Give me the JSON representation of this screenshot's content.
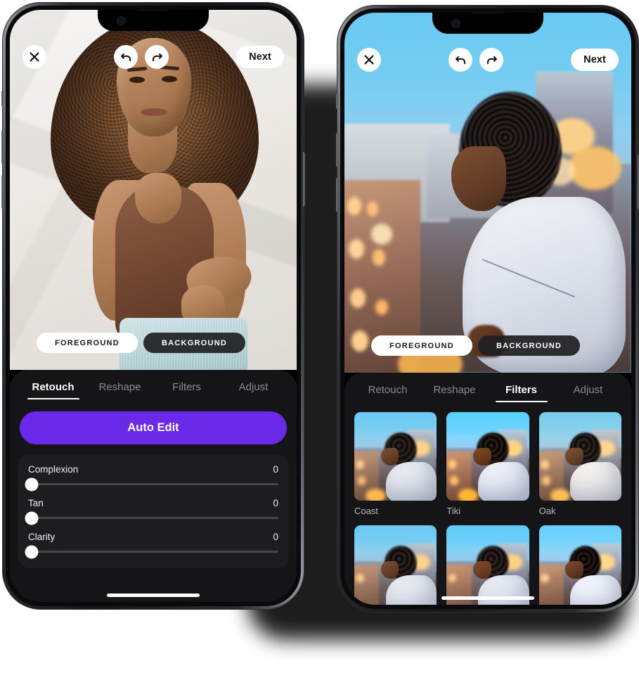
{
  "app": {
    "name": "Photo Editor",
    "accent_purple": "#6A29E9",
    "sheet_background": "#151517",
    "card_background": "#1d1d1f"
  },
  "phones": [
    {
      "id": "left-phone",
      "photo": "studio-portrait-curly-hair-brown-top",
      "toolbar": {
        "close_label": "×",
        "close_icon": "close-icon",
        "undo_icon": "undo-arrow-icon",
        "redo_icon": "redo-arrow-icon",
        "next_label": "Next"
      },
      "segment": {
        "foreground_label": "FOREGROUND",
        "background_label": "BACKGROUND",
        "selected": "FOREGROUND"
      },
      "tabs": [
        {
          "label": "Retouch",
          "active": true
        },
        {
          "label": "Reshape",
          "active": false
        },
        {
          "label": "Filters",
          "active": false
        },
        {
          "label": "Adjust",
          "active": false
        }
      ],
      "auto_edit_label": "Auto Edit",
      "sliders": [
        {
          "label": "Complexion",
          "value": "0",
          "percent": 0
        },
        {
          "label": "Tan",
          "value": "0",
          "percent": 0
        },
        {
          "label": "Clarity",
          "value": "0",
          "percent": 0
        }
      ]
    },
    {
      "id": "right-phone",
      "photo": "rooftop-city-dusk-portrait",
      "toolbar": {
        "close_label": "×",
        "close_icon": "close-icon",
        "undo_icon": "undo-arrow-icon",
        "redo_icon": "redo-arrow-icon",
        "next_label": "Next"
      },
      "segment": {
        "foreground_label": "FOREGROUND",
        "background_label": "BACKGROUND",
        "selected": "FOREGROUND"
      },
      "tabs": [
        {
          "label": "Retouch",
          "active": false
        },
        {
          "label": "Reshape",
          "active": false
        },
        {
          "label": "Filters",
          "active": true
        },
        {
          "label": "Adjust",
          "active": false
        }
      ],
      "filters": [
        {
          "label": "Coast"
        },
        {
          "label": "Tiki"
        },
        {
          "label": "Oak"
        },
        {
          "label": ""
        },
        {
          "label": ""
        },
        {
          "label": ""
        }
      ]
    }
  ]
}
